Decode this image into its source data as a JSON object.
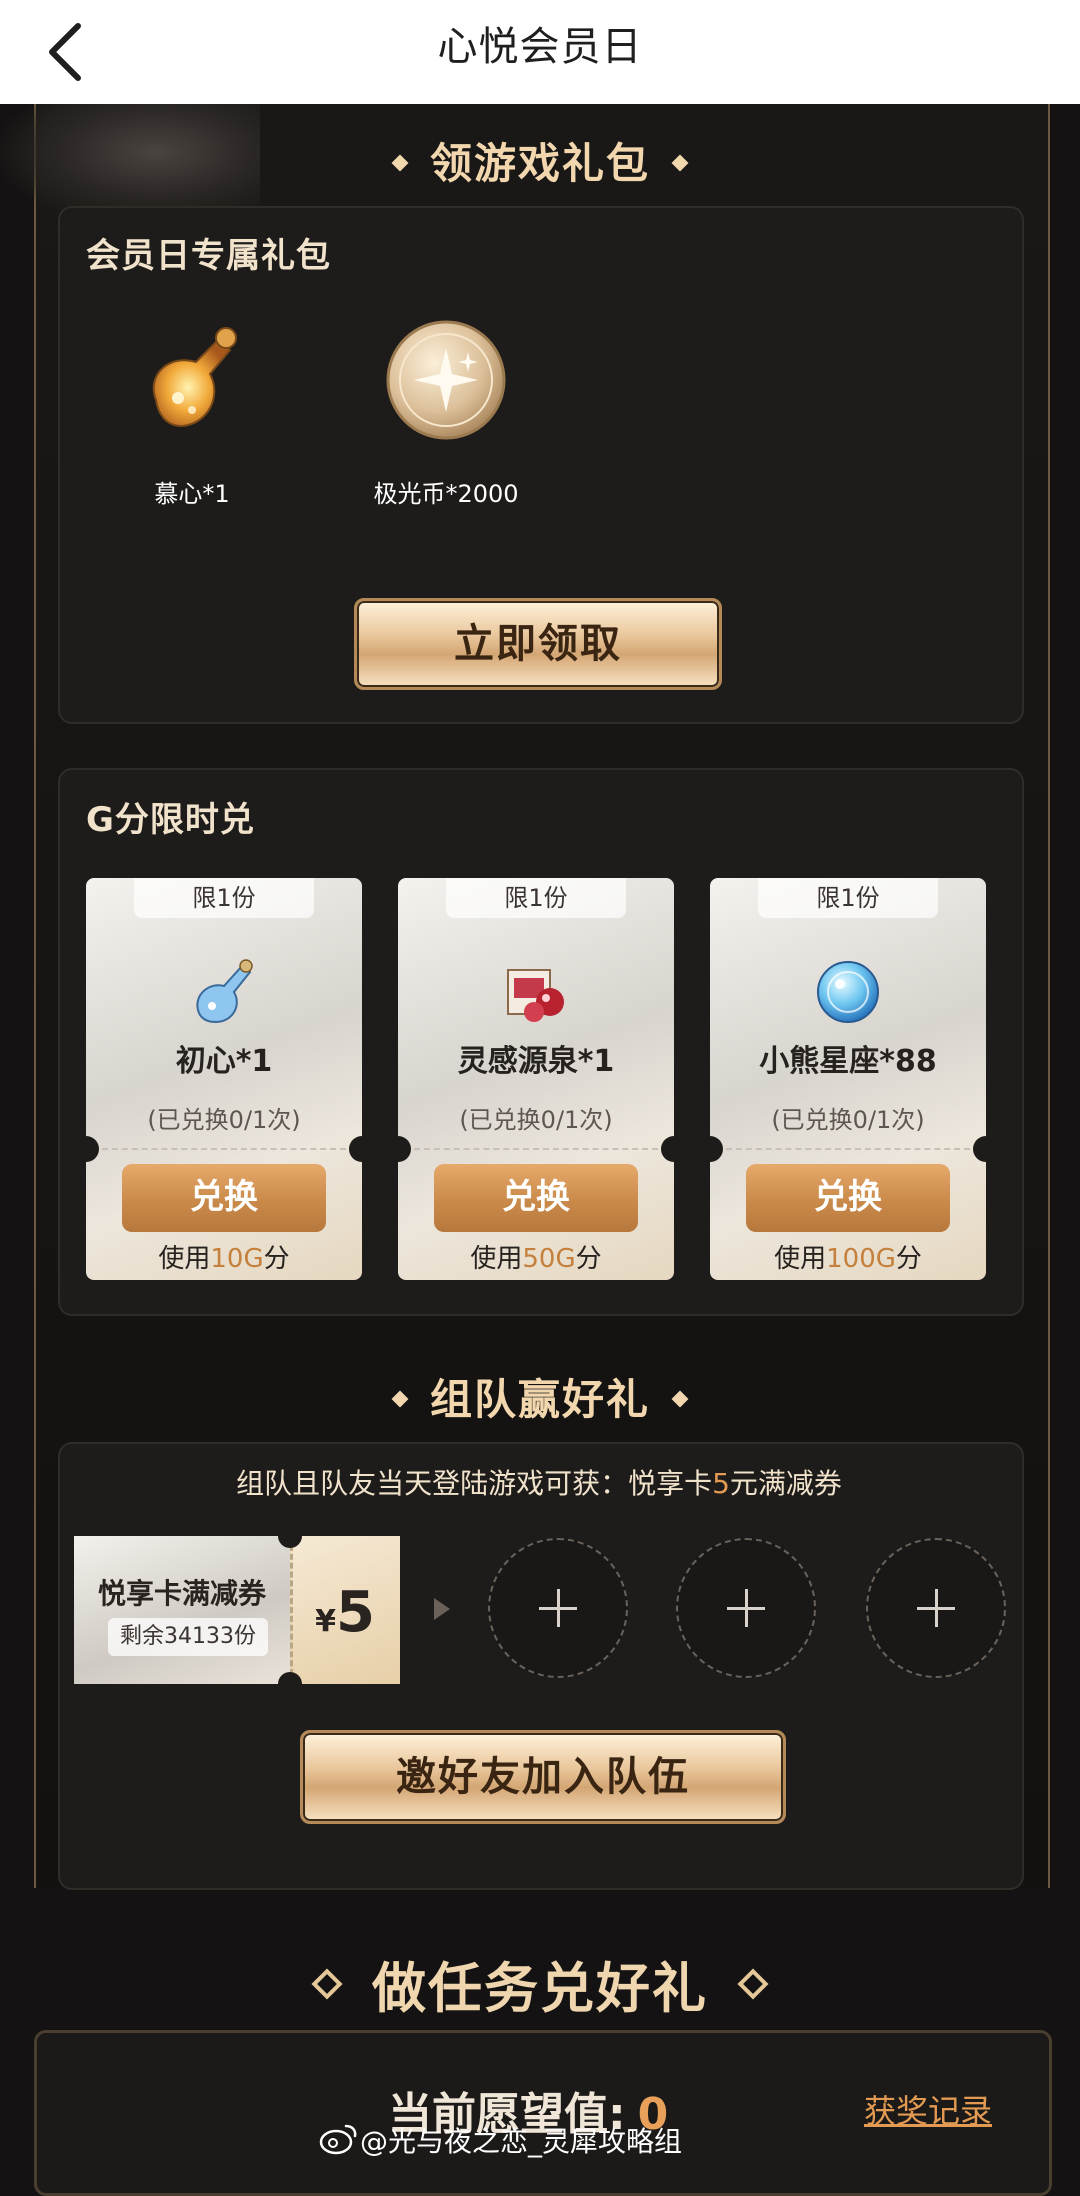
{
  "nav": {
    "title": "心悦会员日"
  },
  "gift_section": {
    "title": "领游戏礼包",
    "card_title": "会员日专属礼包",
    "items": [
      {
        "label": "慕心*1",
        "icon": "perfume-bottle-icon"
      },
      {
        "label": "极光币*2000",
        "icon": "aurora-coin-icon"
      }
    ],
    "claim_label": "立即领取"
  },
  "exchange": {
    "title": "G分限时兑",
    "cards": [
      {
        "limit": "限1份",
        "name": "初心*1",
        "note": "(已兑换0/1次)",
        "button": "兑换",
        "use_prefix": "使用",
        "cost": "10G",
        "use_suffix": "分",
        "icon": "blue-bottle-icon"
      },
      {
        "limit": "限1份",
        "name": "灵感源泉*1",
        "note": "(已兑换0/1次)",
        "button": "兑换",
        "use_prefix": "使用",
        "cost": "50G",
        "use_suffix": "分",
        "icon": "gift-box-icon"
      },
      {
        "limit": "限1份",
        "name": "小熊星座*88",
        "note": "(已兑换0/1次)",
        "button": "兑换",
        "use_prefix": "使用",
        "cost": "100G",
        "use_suffix": "分",
        "icon": "star-orb-icon"
      }
    ]
  },
  "team": {
    "title": "组队赢好礼",
    "desc_prefix": "组队且队友当天登陆游戏可获：悦享卡",
    "desc_highlight": "5",
    "desc_suffix": "元满减券",
    "coupon_name": "悦享卡满减券",
    "coupon_remaining": "剩余34133份",
    "coupon_currency": "¥",
    "coupon_value": "5",
    "invite_label": "邀好友加入队伍"
  },
  "tasks": {
    "title": "做任务兑好礼",
    "wish_label": "当前愿望值:",
    "wish_value": "0",
    "record_label": "获奖记录"
  },
  "watermark": "@光与夜之恋_灵犀攻略组"
}
